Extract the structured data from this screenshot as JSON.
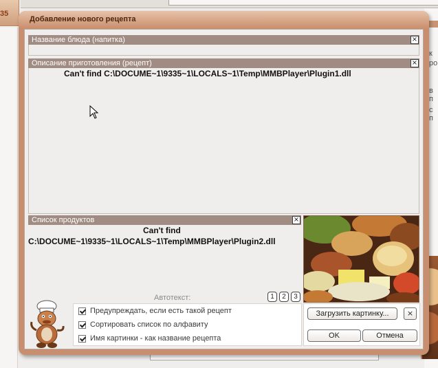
{
  "background": {
    "tab_number": "35",
    "right_fragments": [
      "к",
      "ро",
      "в п",
      "с п"
    ]
  },
  "dialog": {
    "title": "Добавление нового рецепта",
    "dish_name": {
      "label": "Название блюда (напитка)",
      "value": ""
    },
    "description": {
      "label": "Описание приготовления (рецепт)",
      "plugin_error": "Can't find C:\\DOCUME~1\\9335~1\\LOCALS~1\\Temp\\MMBPlayer\\Plugin1.dll"
    },
    "products": {
      "label": "Список продуктов",
      "plugin_error_line1": "Can't find",
      "plugin_error_line2": "C:\\DOCUME~1\\9335~1\\LOCALS~1\\Temp\\MMBPlayer\\Plugin2.dll"
    },
    "autotext": {
      "label": "Автотекст:",
      "buttons": [
        "1",
        "2",
        "3"
      ]
    },
    "options": [
      {
        "label": "Предупреждать, если есть такой рецепт",
        "checked": true
      },
      {
        "label": "Сортировать список по алфавиту",
        "checked": true
      },
      {
        "label": "Имя картинки - как название рецепта",
        "checked": true
      }
    ],
    "load_image_button": "Загрузить картинку...",
    "clear_image_button": "×",
    "close_glyph": "×",
    "ok_button": "OK",
    "cancel_button": "Отмена"
  },
  "icons": [
    "close-icon",
    "chef-mascot-icon",
    "food-picture",
    "mouse-cursor-icon"
  ]
}
